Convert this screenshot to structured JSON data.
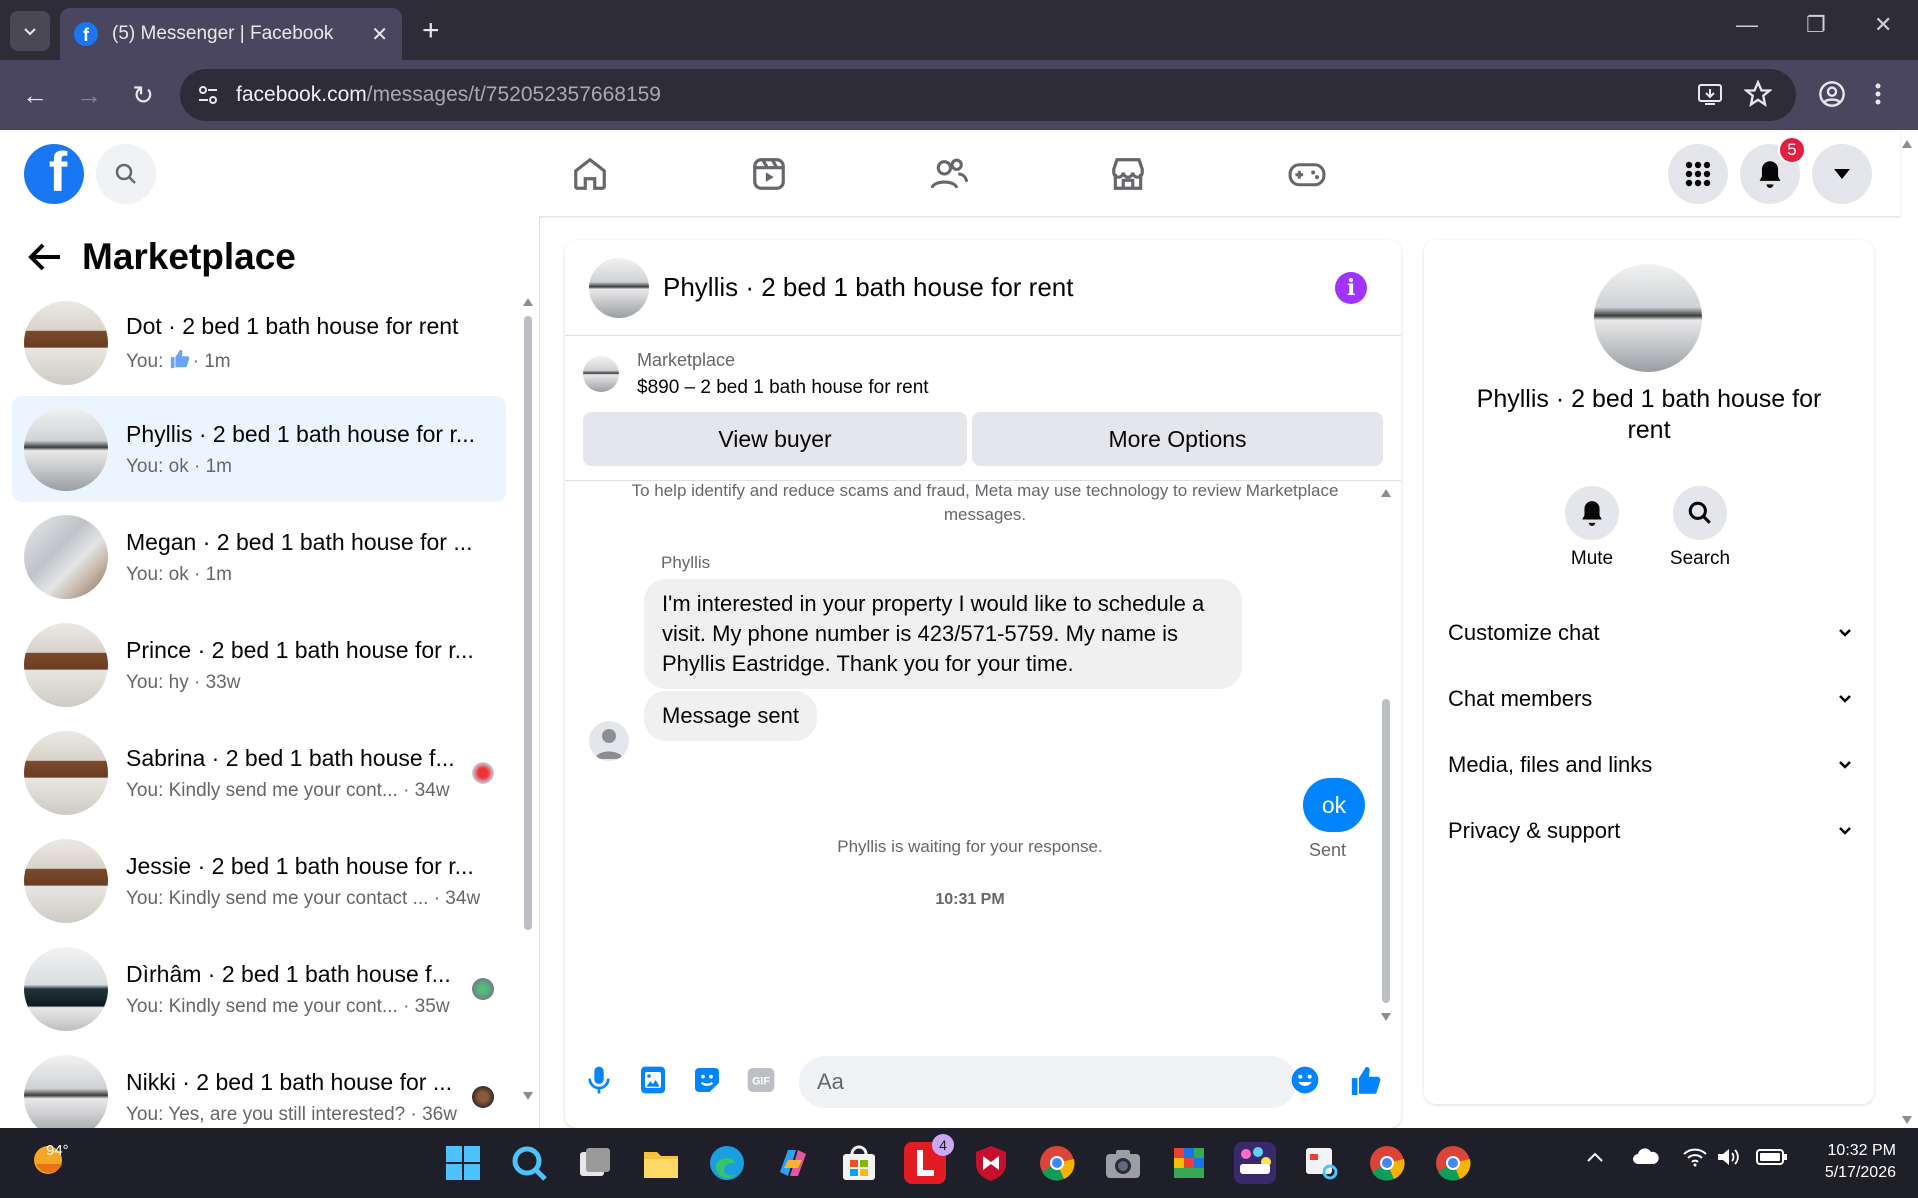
{
  "browser": {
    "tab_title": "(5) Messenger | Facebook",
    "url_domain": "facebook.com",
    "url_path": "/messages/t/752052357668159"
  },
  "header": {
    "notification_count": "5"
  },
  "sidebar": {
    "title": "Marketplace",
    "conversations": [
      {
        "name": "Dot · 2 bed 1 bath house for rent",
        "preview_prefix": "You: ",
        "preview": "",
        "time": "· 1m",
        "has_like": true
      },
      {
        "name": "Phyllis · 2 bed 1 bath house for r...",
        "preview_prefix": "You: ",
        "preview": "ok",
        "time": " · 1m",
        "active": true
      },
      {
        "name": "Megan · 2 bed 1 bath house for ...",
        "preview_prefix": "You: ",
        "preview": "ok",
        "time": " · 1m"
      },
      {
        "name": "Prince · 2 bed 1 bath house for r...",
        "preview_prefix": "You: ",
        "preview": "hy",
        "time": " · 33w"
      },
      {
        "name": "Sabrina · 2 bed 1 bath house f...",
        "preview_prefix": "You: ",
        "preview": "Kindly send me your cont...",
        "time": " · 34w"
      },
      {
        "name": "Jessie · 2 bed 1 bath house for r...",
        "preview_prefix": "You: ",
        "preview": "Kindly send me your contact ...",
        "time": " · 34w"
      },
      {
        "name": "Dìrhâm · 2 bed 1 bath house f...",
        "preview_prefix": "You: ",
        "preview": "Kindly send me your cont...",
        "time": " · 35w"
      },
      {
        "name": "Nikki · 2 bed 1 bath house for ...",
        "preview_prefix": "You: ",
        "preview": "Yes, are you still interested?",
        "time": " · 36w"
      }
    ]
  },
  "chat": {
    "title": "Phyllis · 2 bed 1 bath house for rent",
    "marketplace_label": "Marketplace",
    "listing": "$890 – 2 bed 1 bath house for rent",
    "view_buyer": "View buyer",
    "more_options": "More Options",
    "notice": "To help identify and reduce scams and fraud, Meta may use technology to review Marketplace messages.",
    "sender": "Phyllis",
    "message_1": "I'm interested in your property I would like to schedule a visit. My phone number is 423/571-5759. My name is Phyllis Eastridge.  Thank you for your time.",
    "message_2": "Message sent",
    "waiting": "Phyllis is waiting for your response.",
    "timestamp": "10:31 PM",
    "my_message": "ok",
    "status": "Sent",
    "input_placeholder": "Aa"
  },
  "details": {
    "name": "Phyllis · 2 bed 1 bath house for rent",
    "mute": "Mute",
    "search": "Search",
    "sections": [
      "Customize chat",
      "Chat members",
      "Media, files and links",
      "Privacy & support"
    ]
  },
  "taskbar": {
    "weather": "94°",
    "time": "10:32 PM",
    "date": "5/17/2026",
    "badge_l": "4"
  },
  "colors": {
    "brand": "#1877f2",
    "active_bg": "#ebf5ff",
    "my_bubble": "#0084ff",
    "info": "#a033ff"
  }
}
